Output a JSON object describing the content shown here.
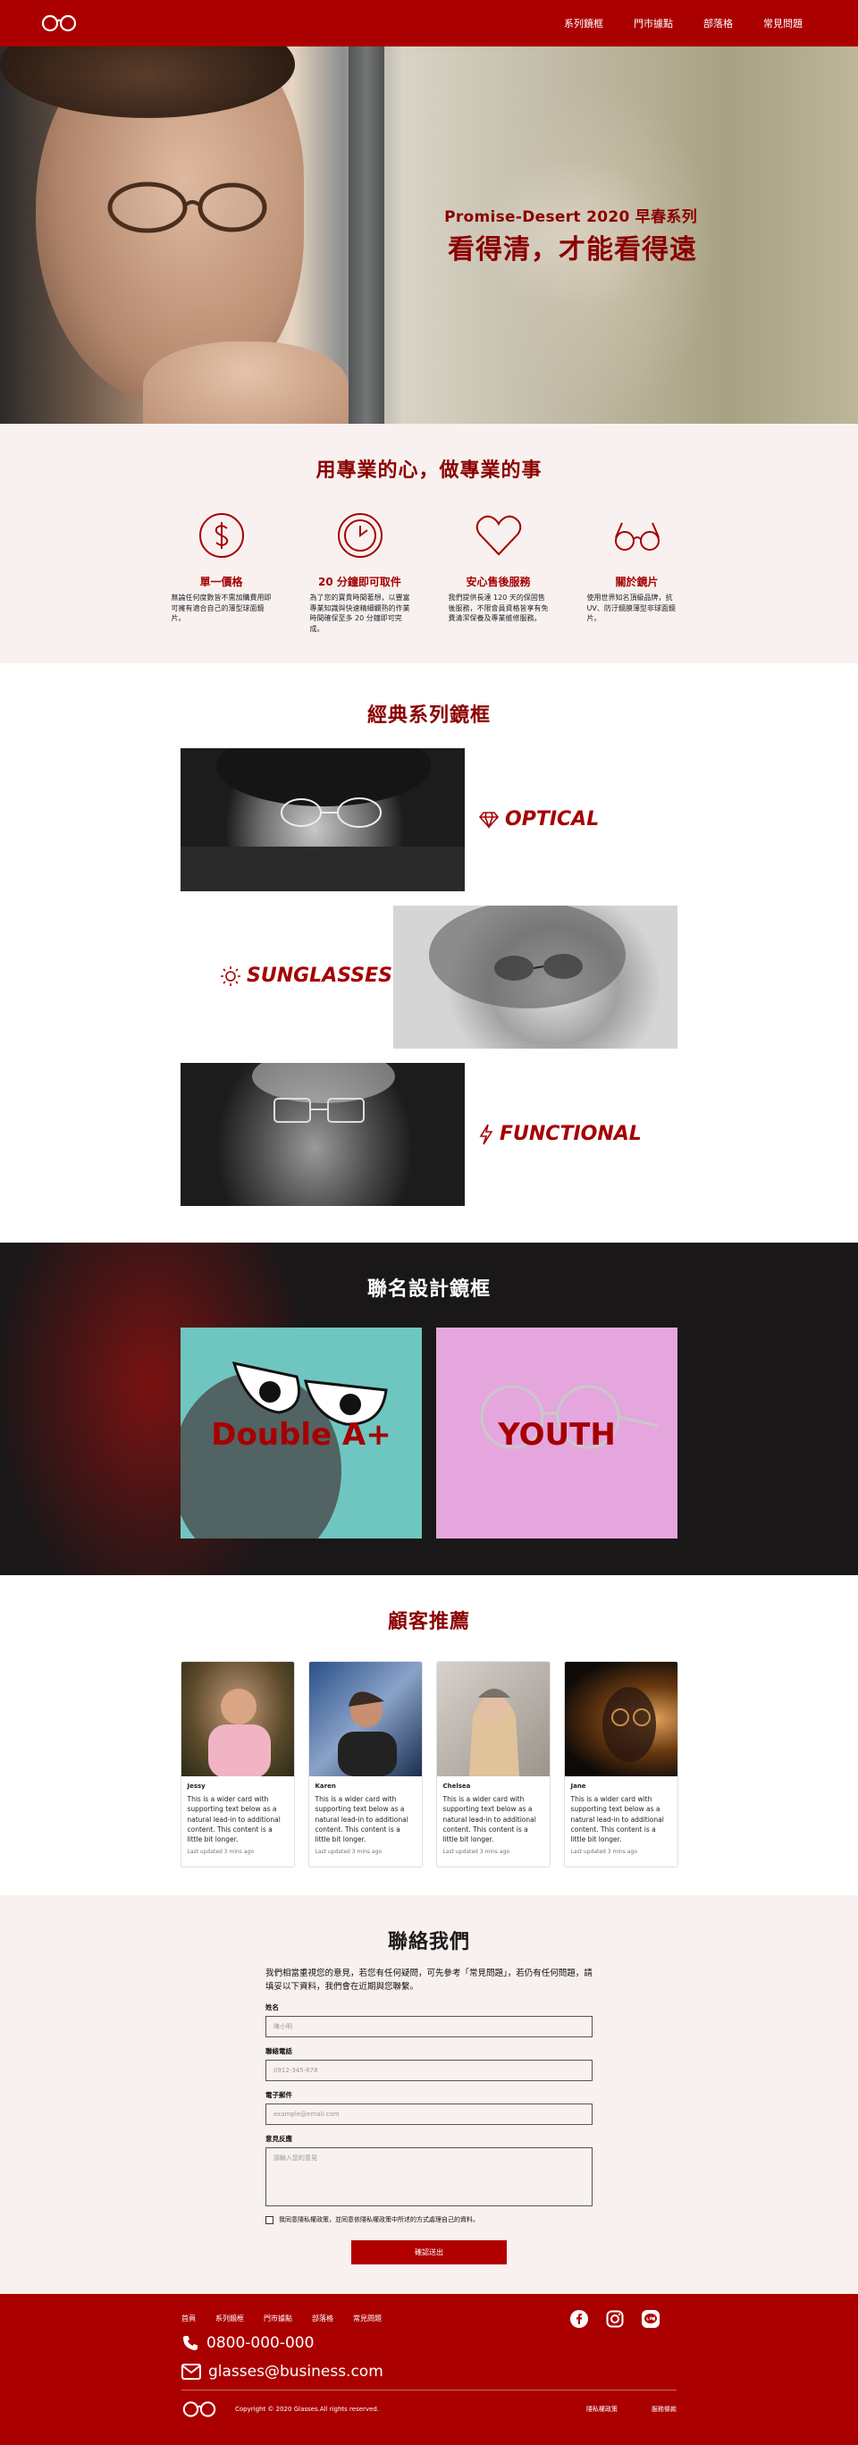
{
  "nav": {
    "logo": "glasses-logo-icon",
    "links": [
      "系列鏡框",
      "門市據點",
      "部落格",
      "常見問題"
    ]
  },
  "hero": {
    "subtitle": "Promise-Desert 2020 早春系列",
    "title": "看得清，才能看得遠"
  },
  "features": {
    "title": "用專業的心，做專業的事",
    "items": [
      {
        "icon": "dollar-icon",
        "title": "單一價格",
        "desc": "無論任何度數皆不需加購費用即可擁有適合自己的薄型球面鏡片。"
      },
      {
        "icon": "clock-icon",
        "title": "20 分鐘即可取件",
        "desc": "為了您的寶貴時間著想，以豐富專業知識與快速精細嫻熟的作業時間確保至多 20 分鐘即可完成。"
      },
      {
        "icon": "heart-icon",
        "title": "安心售後服務",
        "desc": "我們提供長達 120 天的保固售後服務，不限會員資格皆享有免費清潔保養及專業維修服務。"
      },
      {
        "icon": "glasses-icon",
        "title": "關於鏡片",
        "desc": "使用世界知名頂級品牌，抗 UV、防汙鏡膜薄型非球面鏡片。"
      }
    ]
  },
  "classic": {
    "title": "經典系列鏡框",
    "items": [
      {
        "icon": "diamond-icon",
        "label": "OPTICAL"
      },
      {
        "icon": "sun-icon",
        "label": "SUNGLASSES"
      },
      {
        "icon": "lightning-icon",
        "label": "FUNCTIONAL"
      }
    ]
  },
  "collab": {
    "title": "聯名設計鏡框",
    "items": [
      "Double A+",
      "YOUTH"
    ]
  },
  "testimonials": {
    "title": "顧客推薦",
    "cards": [
      {
        "name": "Jessy",
        "text": "This is a wider card with supporting text below as a natural lead-in to additional content. This content is a little bit longer.",
        "time": "Last updated 3 mins ago"
      },
      {
        "name": "Karen",
        "text": "This is a wider card with supporting text below as a natural lead-in to additional content. This content is a little bit longer.",
        "time": "Last updated 3 mins ago"
      },
      {
        "name": "Chelsea",
        "text": "This is a wider card with supporting text below as a natural lead-in to additional content. This content is a little bit longer.",
        "time": "Last updated 3 mins ago"
      },
      {
        "name": "Jane",
        "text": "This is a wider card with supporting text below as a natural lead-in to additional content. This content is a little bit longer.",
        "time": "Last updated 3 mins ago"
      }
    ]
  },
  "contact": {
    "title": "聯絡我們",
    "intro": "我們相當重視您的意見，若您有任何疑問，可先參考「常見問題」，若仍有任何問題，請填妥以下資料，我們會在近期與您聯繫。",
    "name_label": "姓名",
    "name_placeholder": "陳小明",
    "phone_label": "聯絡電話",
    "phone_placeholder": "0912-345-678",
    "email_label": "電子郵件",
    "email_placeholder": "example@email.com",
    "feedback_label": "意見反應",
    "feedback_placeholder": "請輸入您的意見",
    "privacy_text": "我同意隱私權政策，並同意依隱私權政策中所述的方式處理自己的資料。",
    "submit_label": "確認送出"
  },
  "footer": {
    "nav": [
      "首頁",
      "系列鏡框",
      "門市據點",
      "部落格",
      "常見問題"
    ],
    "phone": "0800-000-000",
    "email": "glasses@business.com",
    "copyright": "Copyright © 2020 Glasses.All rights reserved.",
    "privacy": "隱私權政策",
    "terms": "服務條款",
    "social": [
      "facebook-icon",
      "instagram-icon",
      "line-icon"
    ]
  },
  "colors": {
    "brand": "#ab0000",
    "dark_red": "#8b0000",
    "section_bg": "#f8f1ef"
  }
}
